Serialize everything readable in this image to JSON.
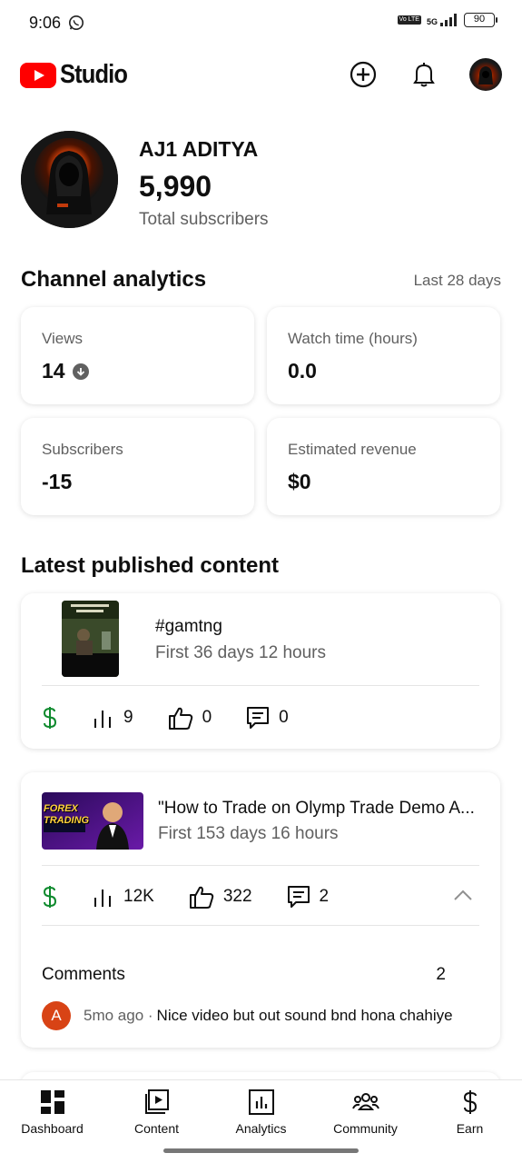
{
  "status_bar": {
    "time": "9:06",
    "network": "5G",
    "volte": "Vo LTE",
    "battery": "90"
  },
  "app": {
    "logo_text": "Studio"
  },
  "channel": {
    "name": "AJ1 ADITYA",
    "subscribers": "5,990",
    "subscribers_label": "Total subscribers"
  },
  "analytics": {
    "title": "Channel analytics",
    "period": "Last 28 days",
    "cards": [
      {
        "label": "Views",
        "value": "14"
      },
      {
        "label": "Watch time (hours)",
        "value": "0.0"
      },
      {
        "label": "Subscribers",
        "value": "-15"
      },
      {
        "label": "Estimated revenue",
        "value": "$0"
      }
    ]
  },
  "latest": {
    "title": "Latest published content",
    "items": [
      {
        "title": "#gamtng",
        "subtitle": "First 36 days 12 hours",
        "views": "9",
        "likes": "0",
        "comments": "0"
      },
      {
        "title": "\"How to Trade on Olymp Trade Demo A...",
        "subtitle": "First 153 days 16 hours",
        "views": "12K",
        "likes": "322",
        "comments": "2",
        "thumb_text": "FOREX TRADING",
        "comments_section": {
          "label": "Comments",
          "count": "2",
          "first": {
            "avatar_letter": "A",
            "meta": "5mo ago ·",
            "text": "Nice video but  out sound bnd hona chahiye"
          }
        }
      }
    ]
  },
  "nav": [
    {
      "label": "Dashboard",
      "icon": "dashboard-icon"
    },
    {
      "label": "Content",
      "icon": "content-icon"
    },
    {
      "label": "Analytics",
      "icon": "analytics-icon"
    },
    {
      "label": "Community",
      "icon": "community-icon"
    },
    {
      "label": "Earn",
      "icon": "earn-icon"
    }
  ],
  "colors": {
    "brand_red": "#ff0000",
    "money_green": "#0f8a2e",
    "secondary_text": "#606060"
  }
}
